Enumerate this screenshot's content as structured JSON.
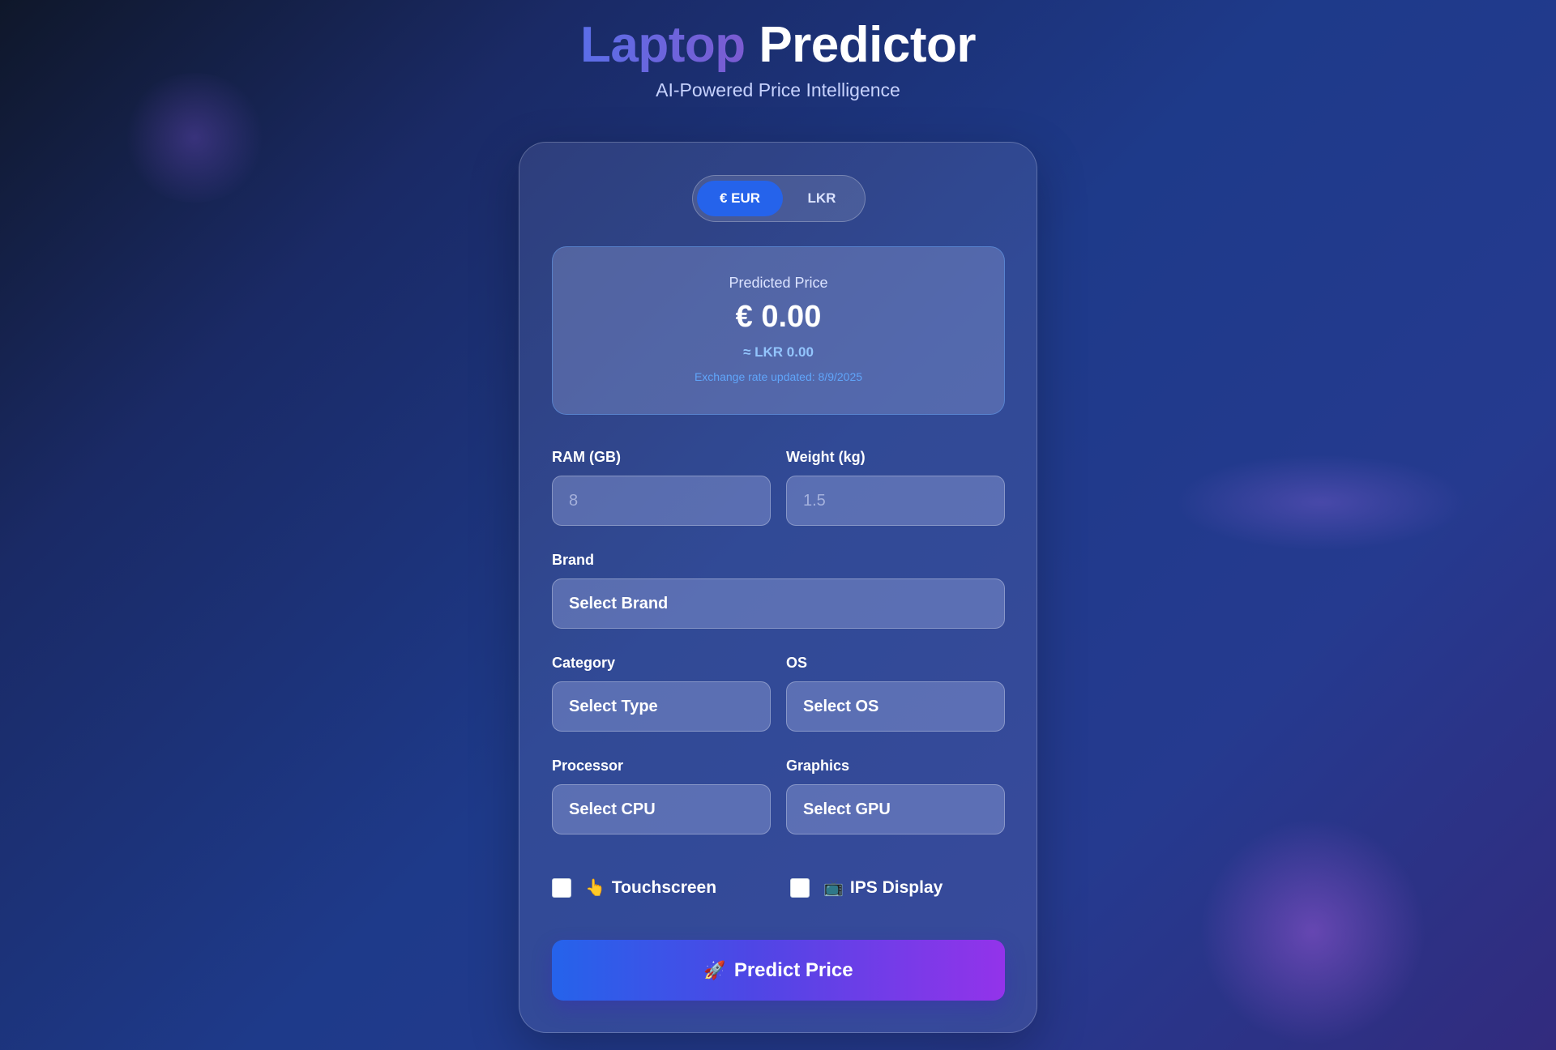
{
  "header": {
    "title_word1": "Laptop",
    "title_word2": "Predictor",
    "subtitle": "AI-Powered Price Intelligence"
  },
  "currency_toggle": {
    "options": [
      "€ EUR",
      "LKR"
    ],
    "selected": "€ EUR"
  },
  "prediction": {
    "label": "Predicted Price",
    "value": "€ 0.00",
    "converted": "≈ LKR 0.00",
    "updated": "Exchange rate updated: 8/9/2025"
  },
  "form": {
    "ram": {
      "label": "RAM (GB)",
      "placeholder": "8"
    },
    "weight": {
      "label": "Weight (kg)",
      "placeholder": "1.5"
    },
    "brand": {
      "label": "Brand",
      "value": "Select Brand"
    },
    "category": {
      "label": "Category",
      "value": "Select Type"
    },
    "os": {
      "label": "OS",
      "value": "Select OS"
    },
    "processor": {
      "label": "Processor",
      "value": "Select CPU"
    },
    "graphics": {
      "label": "Graphics",
      "value": "Select GPU"
    },
    "touchscreen": {
      "icon": "👆",
      "label": "Touchscreen",
      "checked": false
    },
    "ips": {
      "icon": "📺",
      "label": "IPS Display",
      "checked": false
    }
  },
  "predict_button": {
    "icon": "🚀",
    "label": "Predict Price"
  },
  "colors": {
    "accent_blue": "#2563eb",
    "accent_purple": "#9333ea",
    "price_highlight": "#93c5fd"
  }
}
